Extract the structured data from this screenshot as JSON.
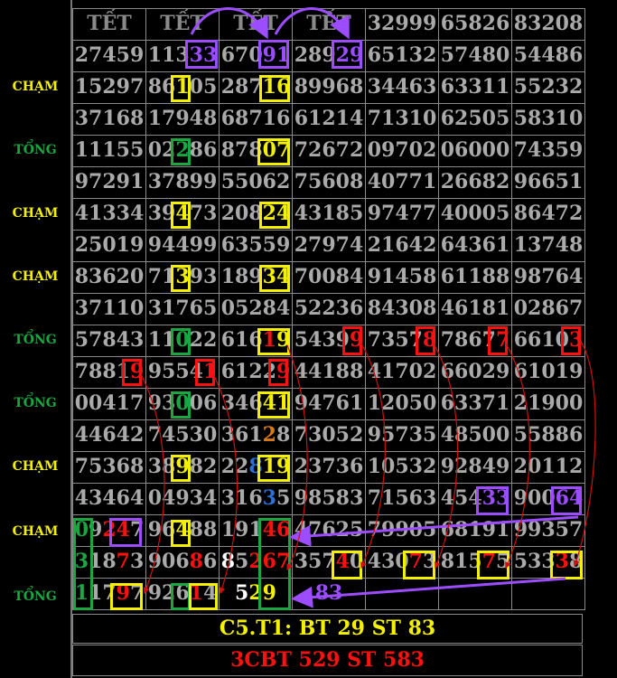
{
  "side_labels": [
    {
      "text": "CHẠM",
      "color": "#f4f000"
    },
    {
      "text": "TỔNG",
      "color": "#1aa640"
    },
    {
      "text": "CHẠM",
      "color": "#f4f000"
    },
    {
      "text": "CHẠM",
      "color": "#f4f000"
    },
    {
      "text": "TỔNG",
      "color": "#1aa640"
    },
    {
      "text": "TỔNG",
      "color": "#1aa640"
    },
    {
      "text": "CHẠM",
      "color": "#f4f000"
    },
    {
      "text": "CHẠM",
      "color": "#f4f000"
    },
    {
      "text": "TỔNG",
      "color": "#1aa640"
    }
  ],
  "rows": [
    [
      "TẾT",
      "TẾT",
      "TẾT",
      "TẾT",
      "32999",
      "65826",
      "83208"
    ],
    [
      "27459",
      "11333",
      "67091",
      "28929",
      "65132",
      "57480",
      "54486"
    ],
    [
      "15297",
      "86105",
      "28716",
      "89968",
      "34463",
      "63311",
      "55232"
    ],
    [
      "37168",
      "17948",
      "68716",
      "61214",
      "71310",
      "62505",
      "58310"
    ],
    [
      "11155",
      "02286",
      "87807",
      "72672",
      "09702",
      "06000",
      "74359"
    ],
    [
      "97291",
      "37899",
      "55062",
      "75608",
      "40771",
      "26682",
      "96651"
    ],
    [
      "41334",
      "39473",
      "20824",
      "43185",
      "97477",
      "40005",
      "86472"
    ],
    [
      "25019",
      "94499",
      "63559",
      "27974",
      "21642",
      "64361",
      "13748"
    ],
    [
      "83620",
      "71393",
      "18934",
      "70084",
      "91458",
      "61188",
      "98764"
    ],
    [
      "37110",
      "31765",
      "05284",
      "52236",
      "84308",
      "46181",
      "02867"
    ],
    [
      "57843",
      "11022",
      "61619",
      "54399",
      "73578",
      "78677",
      "66103"
    ],
    [
      "78819",
      "95541",
      "61229",
      "44188",
      "41702",
      "66029",
      "61019"
    ],
    [
      "00417",
      "93006",
      "34641",
      "94761",
      "12050",
      "63371",
      "21900"
    ],
    [
      "44642",
      "74530",
      "36128",
      "73052",
      "95735",
      "48500",
      "55886"
    ],
    [
      "75368",
      "38982",
      "22819",
      "23736",
      "10532",
      "92849",
      "20112"
    ],
    [
      "43464",
      "04934",
      "31635",
      "98583",
      "71563",
      "45433",
      "90064"
    ],
    [
      "09247",
      "96488",
      "19146",
      "47625",
      "79905",
      "68191",
      "99357"
    ],
    [
      "31873",
      "90686",
      "85267",
      "35740",
      "43073",
      "81575",
      "53338"
    ],
    [
      "11797",
      "92614",
      "529",
      "83",
      "",
      "",
      ""
    ]
  ],
  "footer": {
    "line1": "C5.T1: BT 29 ST 83",
    "line2": "3CBT 529 ST 583"
  },
  "colors": {
    "yellow": "#f4f000",
    "green": "#1aa640",
    "red": "#ff1010",
    "purple": "#9b4dff",
    "grey_text": "#aaaaaa"
  }
}
